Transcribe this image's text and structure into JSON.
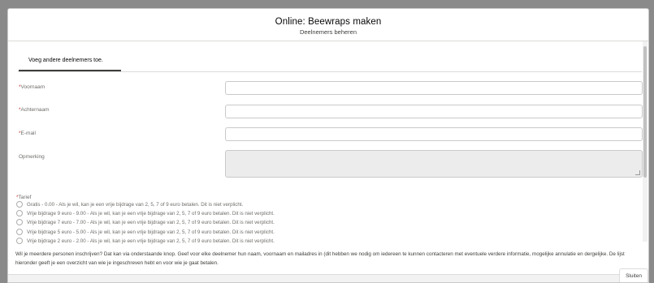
{
  "modal": {
    "title": "Online: Beewraps maken",
    "subtitle": "Deelnemers beheren"
  },
  "tabs": [
    {
      "label": "Voeg andere deelnemers toe."
    }
  ],
  "form": {
    "required_marker": "*",
    "fields": [
      {
        "label": "Voornaam",
        "required": true,
        "value": ""
      },
      {
        "label": "Achternaam",
        "required": true,
        "value": ""
      },
      {
        "label": "E-mail",
        "required": true,
        "value": ""
      },
      {
        "label": "Opmerking",
        "required": false,
        "value": ""
      }
    ]
  },
  "tarief": {
    "label": "Tarief",
    "required": true,
    "options": [
      {
        "label": "Gratis - 0.00 - Als je wil, kan je een vrije bijdrage van 2, 5, 7 of 9 euro betalen. Dit is niet verplicht.",
        "selected": false
      },
      {
        "label": "Vrije bijdrage 9 euro - 9.00 - Als je wil, kan je een vrije bijdrage van 2, 5, 7 of 9 euro betalen. Dit is niet verplicht.",
        "selected": false
      },
      {
        "label": "Vrije bijdrage 7 euro - 7.00 - Als je wil, kan je een vrije bijdrage van 2, 5, 7 of 9 euro betalen. Dit is niet verplicht.",
        "selected": false
      },
      {
        "label": "Vrije bijdrage 5 euro - 5.00 - Als je wil, kan je een vrije bijdrage van 2, 5, 7 of 9 euro betalen. Dit is niet verplicht.",
        "selected": false
      },
      {
        "label": "Vrije bijdrage 2 euro - 2.00 - Als je wil, kan je een vrije bijdrage van 2, 5, 7 of 9 euro betalen. Dit is niet verplicht.",
        "selected": false
      }
    ]
  },
  "info_text": "Wil je meerdere personen inschrijven? Dat kan via onderstaande knop. Geef voor elke deelnemer hun naam, voornaam en mailadres in (dit hebben we nodig om iedereen te kunnen contacteren met eventuele verdere informatie, mogelijke annulatie en dergelijke. De lijst hieronder geeft je een overzicht van wie je ingeschreven hebt en voor wie je gaat betalen.",
  "footer": {
    "close_label": "Sluiten"
  }
}
